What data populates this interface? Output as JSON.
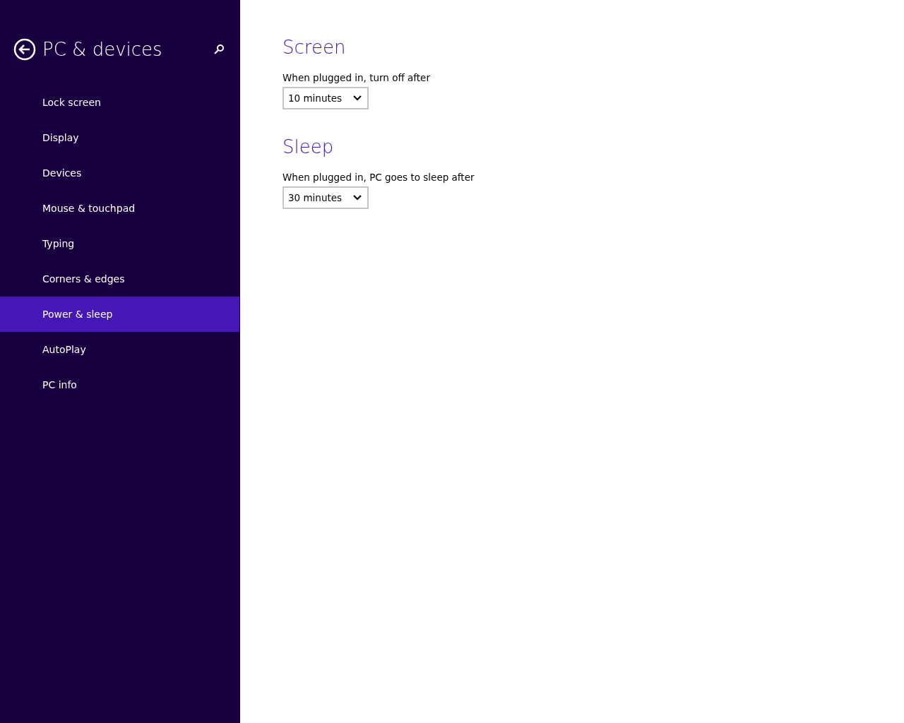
{
  "sidebar": {
    "title": "PC & devices",
    "items": [
      {
        "label": "Lock screen",
        "selected": false
      },
      {
        "label": "Display",
        "selected": false
      },
      {
        "label": "Devices",
        "selected": false
      },
      {
        "label": "Mouse & touchpad",
        "selected": false
      },
      {
        "label": "Typing",
        "selected": false
      },
      {
        "label": "Corners & edges",
        "selected": false
      },
      {
        "label": "Power & sleep",
        "selected": true
      },
      {
        "label": "AutoPlay",
        "selected": false
      },
      {
        "label": "PC info",
        "selected": false
      }
    ]
  },
  "sections": [
    {
      "heading": "Screen",
      "label": "When plugged in, turn off after",
      "value": "10 minutes"
    },
    {
      "heading": "Sleep",
      "label": "When plugged in, PC goes to sleep after",
      "value": "30 minutes"
    }
  ]
}
